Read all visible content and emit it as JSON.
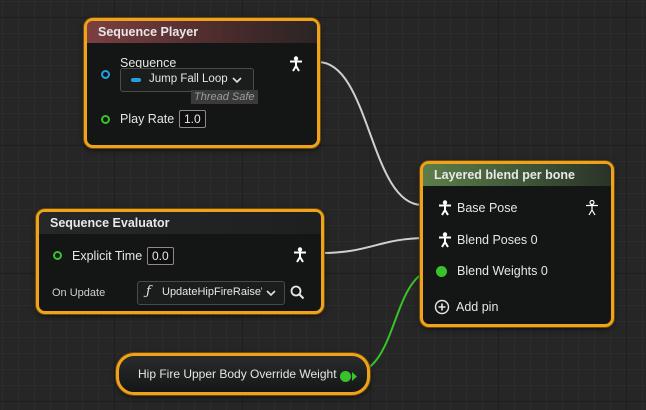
{
  "nodes": {
    "sequence_player": {
      "title": "Sequence Player",
      "sequence_label": "Sequence",
      "sequence_value": "Jump Fall Loop",
      "thread_safe": "Thread Safe",
      "play_rate_label": "Play Rate",
      "play_rate_value": "1.0"
    },
    "sequence_evaluator": {
      "title": "Sequence Evaluator",
      "explicit_time_label": "Explicit Time",
      "explicit_time_value": "0.0",
      "on_update_label": "On Update",
      "on_update_value": "UpdateHipFireRaiseWea",
      "function_glyph": "ƒ"
    },
    "layered_blend": {
      "title": "Layered blend per bone",
      "pins": [
        "Base Pose",
        "Blend Poses 0",
        "Blend Weights 0"
      ],
      "add_pin_label": "Add pin"
    },
    "variable": {
      "label": "Hip Fire Upper Body Override Weight"
    }
  },
  "colors": {
    "selection_outline": "#f0a21a",
    "pose_pin": "#ffffff",
    "float_pin": "#3ac22a",
    "sequence_pin": "#1fa3e0",
    "pose_wire": "#d0d0d0",
    "float_wire": "#3ac22a"
  },
  "icons": [
    "pose-icon",
    "chevron-down-icon",
    "search-icon",
    "function-icon",
    "add-pin-icon",
    "sequence-asset-icon"
  ]
}
